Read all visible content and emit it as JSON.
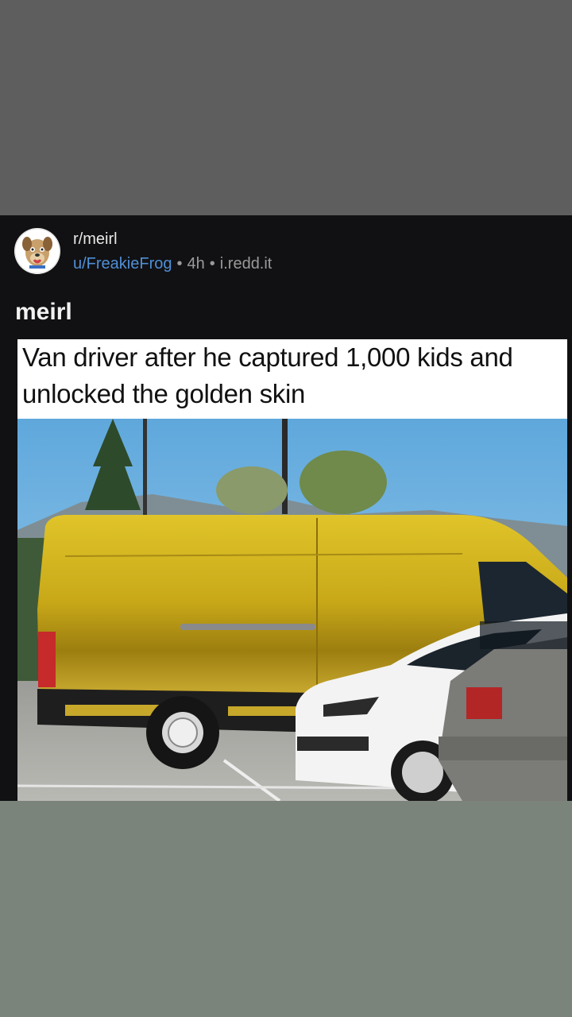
{
  "post": {
    "subreddit": "r/meirl",
    "username": "u/FreakieFrog",
    "age": "4h",
    "domain": "i.redd.it",
    "separator": "•",
    "title": "meirl"
  },
  "meme": {
    "caption_line1": "Van driver after he captured 1,000 kids and",
    "caption_line2": "unlocked the golden skin"
  },
  "colors": {
    "username": "#4f8fd6",
    "card_background": "#111113",
    "van_gold": "#c8a818"
  }
}
